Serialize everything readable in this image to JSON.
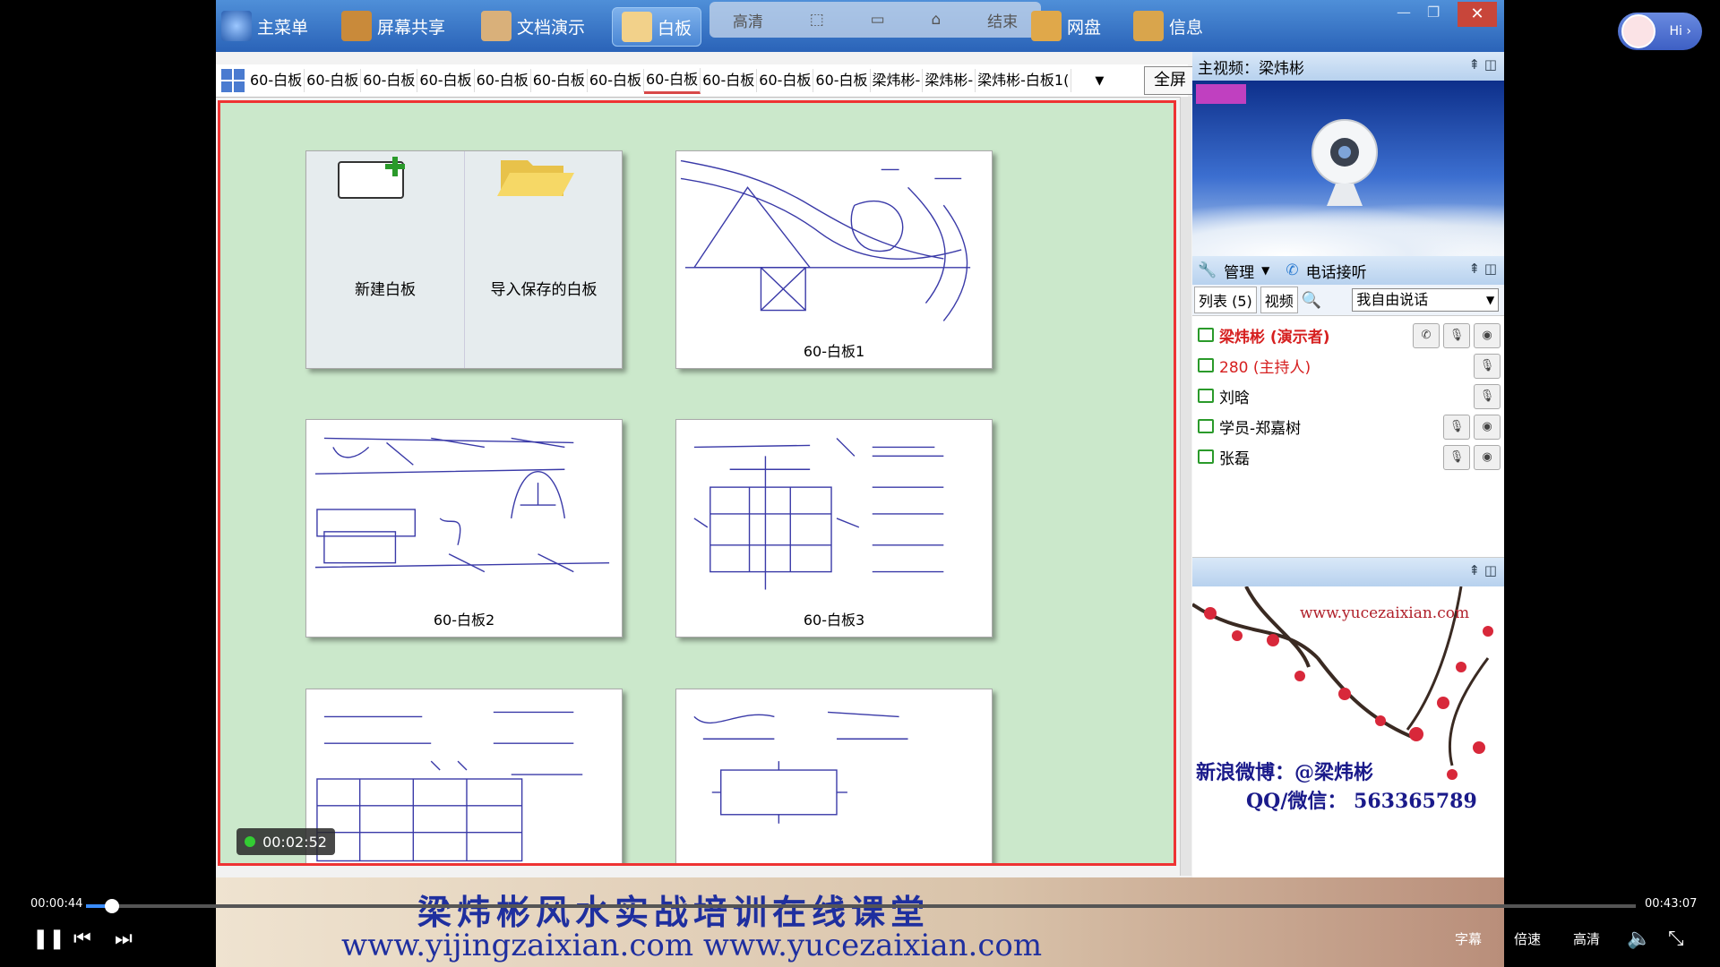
{
  "toolbar": {
    "main_menu": "主菜单",
    "screen_share": "屏幕共享",
    "doc_demo": "文档演示",
    "whiteboard": "白板",
    "overlay": [
      "高清",
      "",
      "",
      "",
      "结束"
    ],
    "netdisk": "网盘",
    "info": "信息"
  },
  "tabs": {
    "items": [
      "60-白板",
      "60-白板",
      "60-白板",
      "60-白板",
      "60-白板",
      "60-白板",
      "60-白板",
      "60-白板",
      "60-白板",
      "60-白板",
      "60-白板",
      "梁炜彬-",
      "梁炜彬-",
      "梁炜彬-白板1("
    ],
    "active_index": 7,
    "fullscreen": "全屏"
  },
  "board": {
    "new_board": "新建白板",
    "import_board": "导入保存的白板",
    "cards": [
      "60-白板1",
      "60-白板2",
      "60-白板3"
    ],
    "timer": "00:02:52"
  },
  "right_panel": {
    "main_video": "主视频：梁炜彬",
    "manage": "管理",
    "phone": "电话接听",
    "list_tab": "列表 (5)",
    "video_tab": "视频",
    "speak_mode": "我自由说话",
    "users": [
      {
        "name": "梁炜彬 (演示者)",
        "color": "#d62020"
      },
      {
        "name": "280 (主持人)",
        "color": "#d62020"
      },
      {
        "name": "刘晗",
        "color": "#000000"
      },
      {
        "name": "学员-郑嘉树",
        "color": "#000000"
      },
      {
        "name": "张磊",
        "color": "#000000"
      }
    ],
    "ad_url": "www.yucezaixian.com",
    "ad_weibo": "新浪微博：@梁炜彬",
    "ad_qq": "QQ/微信： 563365789"
  },
  "banner": {
    "title": "梁炜彬风水实战培训在线课堂",
    "urls": "www.yijingzaixian.com  www.yucezaixian.com"
  },
  "player": {
    "current": "00:00:44",
    "total": "00:43:07",
    "progress": 0.017,
    "subtitle": "字幕",
    "speed": "倍速",
    "quality": "高清"
  },
  "badge": {
    "text": "Hi ›"
  }
}
